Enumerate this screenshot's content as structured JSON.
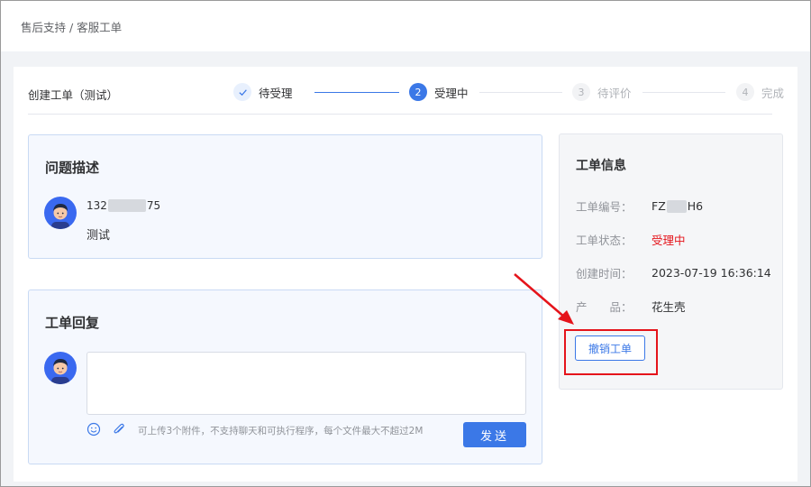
{
  "header": {
    "breadcrumb": "售后支持 / 客服工单"
  },
  "ticket": {
    "title": "创建工单（测试）"
  },
  "steps": [
    {
      "label": "待受理",
      "marker": "✓",
      "state": "done"
    },
    {
      "label": "受理中",
      "marker": "2",
      "state": "active"
    },
    {
      "label": "待评价",
      "marker": "3",
      "state": "pending"
    },
    {
      "label": "完成",
      "marker": "4",
      "state": "pending"
    }
  ],
  "problem": {
    "title": "问题描述",
    "phone_prefix": "132",
    "phone_suffix": "75",
    "description": "测试"
  },
  "reply": {
    "title": "工单回复",
    "textarea_value": "",
    "hint": "可上传3个附件，不支持聊天和可执行程序，每个文件最大不超过2M",
    "send_label": "发送",
    "icons": [
      "emoji-icon",
      "paperclip-icon"
    ]
  },
  "info": {
    "title": "工单信息",
    "number_label": "工单编号：",
    "number_prefix": "FZ",
    "number_suffix": "H6",
    "status_label": "工单状态：",
    "status_value": "受理中",
    "created_label": "创建时间：",
    "created_value": "2023-07-19 16:36:14",
    "product_label": "产　　品：",
    "product_value": "花生壳",
    "cancel_label": "撤销工单"
  },
  "colors": {
    "accent": "#3b78e7",
    "status": "#e5141b",
    "annotation": "#e5141b"
  }
}
